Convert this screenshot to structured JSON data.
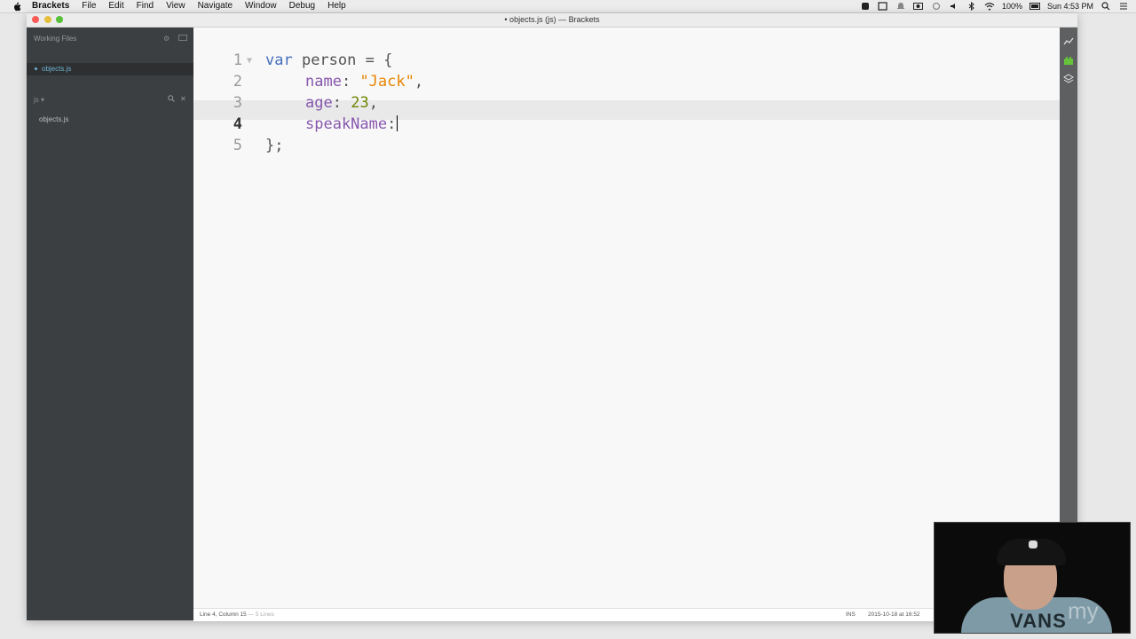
{
  "menubar": {
    "app_name": "Brackets",
    "items": [
      "File",
      "Edit",
      "Find",
      "View",
      "Navigate",
      "Window",
      "Debug",
      "Help"
    ],
    "battery": "100%",
    "clock": "Sun 4:53 PM"
  },
  "window": {
    "title": "• objects.js (js) — Brackets"
  },
  "sidebar": {
    "working_files_header": "Working Files",
    "working_file": "objects.js",
    "project_name": "js ▾",
    "tree_file": "objects.js"
  },
  "editor": {
    "line_numbers": [
      "1",
      "2",
      "3",
      "4",
      "5"
    ],
    "line1": {
      "kw": "var",
      "rest": " person = {"
    },
    "line2": {
      "prop": "name",
      "colon": ": ",
      "str": "\"Jack\"",
      "end": ","
    },
    "line3": {
      "prop": "age",
      "colon": ": ",
      "num": "23",
      "end": ","
    },
    "line4": {
      "prop": "speakName",
      "colon": ":"
    },
    "line5": {
      "text": "};"
    }
  },
  "statusbar": {
    "cursor_position": "Line 4, Column 15",
    "lines_count": " — 5 Lines",
    "ins": "INS",
    "modified_date": "2015-10-18 at 16:52"
  },
  "webcam": {
    "shirt_text": "VANS",
    "watermark": "my"
  },
  "colors": {
    "keyword": "#446fbd",
    "property": "#8757ad",
    "string": "#e88501",
    "number": "#6d8600",
    "sidebar_bg": "#3c3f41"
  }
}
